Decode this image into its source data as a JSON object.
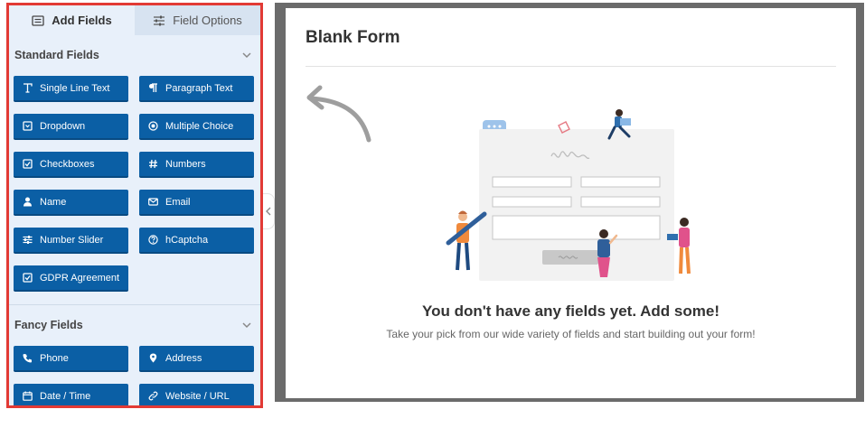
{
  "tabs": [
    {
      "label": "Add Fields",
      "icon": "list-icon",
      "active": true
    },
    {
      "label": "Field Options",
      "icon": "sliders-icon",
      "active": false
    }
  ],
  "sections": {
    "standard": {
      "title": "Standard Fields",
      "fields": [
        {
          "label": "Single Line Text",
          "icon": "text-icon"
        },
        {
          "label": "Paragraph Text",
          "icon": "paragraph-icon"
        },
        {
          "label": "Dropdown",
          "icon": "dropdown-icon"
        },
        {
          "label": "Multiple Choice",
          "icon": "radio-icon"
        },
        {
          "label": "Checkboxes",
          "icon": "checkbox-icon"
        },
        {
          "label": "Numbers",
          "icon": "hash-icon"
        },
        {
          "label": "Name",
          "icon": "user-icon"
        },
        {
          "label": "Email",
          "icon": "envelope-icon"
        },
        {
          "label": "Number Slider",
          "icon": "sliders-icon"
        },
        {
          "label": "hCaptcha",
          "icon": "question-circle-icon"
        },
        {
          "label": "GDPR Agreement",
          "icon": "checkbox-icon"
        }
      ]
    },
    "fancy": {
      "title": "Fancy Fields",
      "fields": [
        {
          "label": "Phone",
          "icon": "phone-icon"
        },
        {
          "label": "Address",
          "icon": "map-pin-icon"
        },
        {
          "label": "Date / Time",
          "icon": "calendar-icon"
        },
        {
          "label": "Website / URL",
          "icon": "link-icon"
        }
      ]
    }
  },
  "form": {
    "title": "Blank Form",
    "empty_heading": "You don't have any fields yet. Add some!",
    "empty_sub": "Take your pick from our wide variety of fields and start building out your form!"
  },
  "colors": {
    "button": "#0b5fa5",
    "panel_bg": "#e8f0fa",
    "highlight_border": "#e23a35",
    "frame_gray": "#6b6b6b"
  }
}
